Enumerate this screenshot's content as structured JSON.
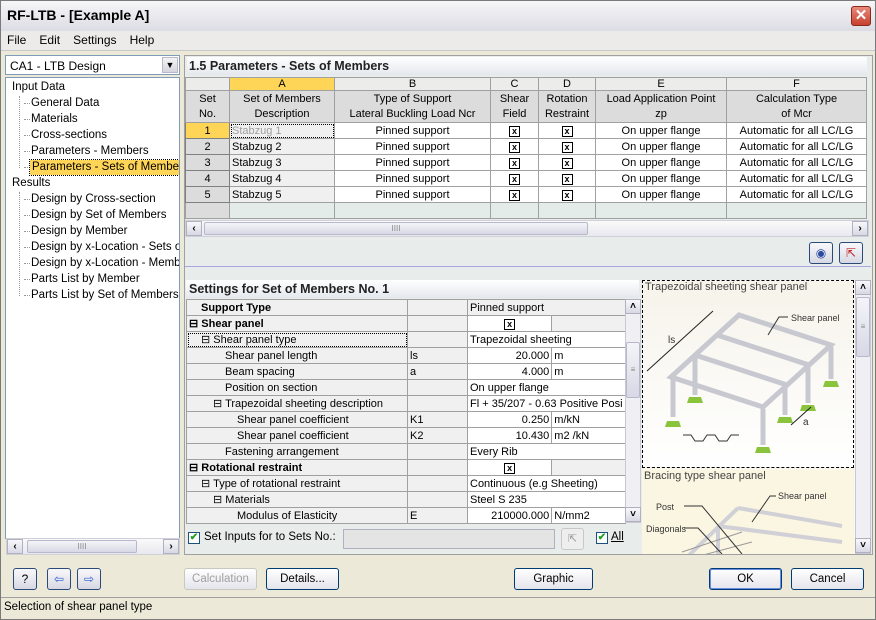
{
  "window": {
    "title": "RF-LTB - [Example A]",
    "close_icon": "close-icon"
  },
  "menu": [
    "File",
    "Edit",
    "Settings",
    "Help"
  ],
  "case_combo": {
    "value": "CA1 - LTB Design"
  },
  "tree": {
    "input_root": "Input Data",
    "input_items": [
      "General Data",
      "Materials",
      "Cross-sections",
      "Parameters - Members",
      "Parameters - Sets of Members"
    ],
    "results_root": "Results",
    "result_items": [
      "Design by Cross-section",
      "Design by Set of Members",
      "Design by Member",
      "Design by x-Location - Sets of Members",
      "Design by x-Location - Members",
      "Parts List by Member",
      "Parts List by Set of Members"
    ],
    "selected": "Parameters - Sets of Members"
  },
  "section": {
    "title": "1.5 Parameters - Sets of Members"
  },
  "grid": {
    "letters": [
      "A",
      "B",
      "C",
      "D",
      "E",
      "F"
    ],
    "rownum_header": [
      "Set",
      "No."
    ],
    "headers": [
      [
        "Set of Members",
        "Description"
      ],
      [
        "Type of Support",
        "Lateral Buckling Load Ncr"
      ],
      [
        "Shear",
        "Field"
      ],
      [
        "Rotation",
        "Restraint"
      ],
      [
        "Load Application Point",
        "zp"
      ],
      [
        "Calculation Type",
        "of Mcr"
      ]
    ],
    "rows": [
      {
        "no": "1",
        "desc": "Stabzug 1",
        "support": "Pinned support",
        "shear": "x",
        "rotation": "x",
        "load": "On upper flange",
        "calc": "Automatic for all LC/LG"
      },
      {
        "no": "2",
        "desc": "Stabzug 2",
        "support": "Pinned support",
        "shear": "x",
        "rotation": "x",
        "load": "On upper flange",
        "calc": "Automatic for all LC/LG"
      },
      {
        "no": "3",
        "desc": "Stabzug 3",
        "support": "Pinned support",
        "shear": "x",
        "rotation": "x",
        "load": "On upper flange",
        "calc": "Automatic for all LC/LG"
      },
      {
        "no": "4",
        "desc": "Stabzug 4",
        "support": "Pinned support",
        "shear": "x",
        "rotation": "x",
        "load": "On upper flange",
        "calc": "Automatic for all LC/LG"
      },
      {
        "no": "5",
        "desc": "Stabzug 5",
        "support": "Pinned support",
        "shear": "x",
        "rotation": "x",
        "load": "On upper flange",
        "calc": "Automatic for all LC/LG"
      }
    ]
  },
  "settings": {
    "title": "Settings for Set of Members No. 1",
    "rows": [
      {
        "label": "Support Type",
        "sym": "",
        "value": "Pinned support",
        "unit": ""
      },
      {
        "label": "Shear panel",
        "sym": "",
        "value": "x",
        "unit": ""
      },
      {
        "label": "Shear panel type",
        "sym": "",
        "value": "Trapezoidal sheeting",
        "unit": ""
      },
      {
        "label": "Shear panel length",
        "sym": "ls",
        "value": "20.000",
        "unit": "m"
      },
      {
        "label": "Beam spacing",
        "sym": "a",
        "value": "4.000",
        "unit": "m"
      },
      {
        "label": "Position on section",
        "sym": "",
        "value": "On upper flange",
        "unit": ""
      },
      {
        "label": "Trapezoidal sheeting description",
        "sym": "",
        "value": "Fl + 35/207 - 0.63 Positive Posi",
        "unit": ""
      },
      {
        "label": "Shear panel coefficient",
        "sym": "K1",
        "value": "0.250",
        "unit": "m/kN"
      },
      {
        "label": "Shear panel coefficient",
        "sym": "K2",
        "value": "10.430",
        "unit": "m2 /kN"
      },
      {
        "label": "Fastening arrangement",
        "sym": "",
        "value": "Every Rib",
        "unit": ""
      },
      {
        "label": "Rotational restraint",
        "sym": "",
        "value": "x",
        "unit": ""
      },
      {
        "label": "Type of rotational restraint",
        "sym": "",
        "value": "Continuous (e.g Sheeting)",
        "unit": ""
      },
      {
        "label": "Materials",
        "sym": "",
        "value": "Steel S 235",
        "unit": ""
      },
      {
        "label": "Modulus of Elasticity",
        "sym": "E",
        "value": "210000.000",
        "unit": "N/mm2"
      }
    ]
  },
  "preview": {
    "caption1": "Trapezoidal sheeting shear panel",
    "label_shear": "Shear panel",
    "label_ls": "ls",
    "label_a": "a",
    "caption2": "Bracing type shear panel",
    "label_post": "Post",
    "label_diag": "Diagonals",
    "label_shear2": "Shear panel"
  },
  "set_inputs": {
    "label": "Set Inputs for to Sets No.:",
    "value": "",
    "all_label": "All",
    "checked": true,
    "all_checked": true
  },
  "buttons": {
    "calculation": "Calculation",
    "details": "Details...",
    "graphic": "Graphic",
    "ok": "OK",
    "cancel": "Cancel"
  },
  "status": "Selection of shear panel type"
}
